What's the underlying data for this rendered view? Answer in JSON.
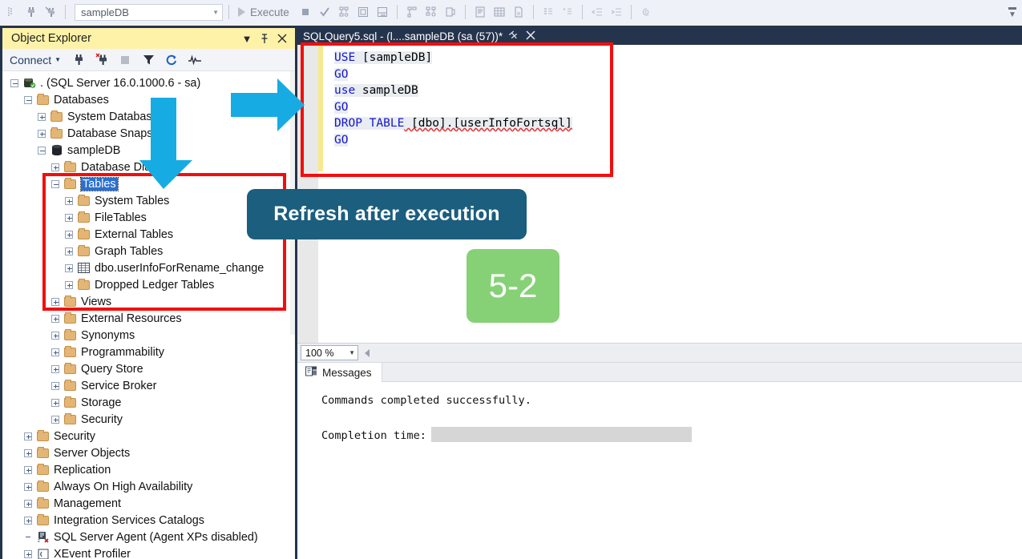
{
  "toolbar": {
    "database_value": "sampleDB",
    "execute_label": "Execute",
    "icons": [
      "connect-object-explorer-icon",
      "new-query-icon",
      "new-query-with-current-connection-icon",
      "stop-icon",
      "parse-icon",
      "display-estimated-execution-plan-icon",
      "query-options-icon",
      "intellisense-icon",
      "include-actual-execution-plan-icon",
      "include-live-query-statistics-icon",
      "include-client-statistics-icon",
      "results-to-text-icon",
      "results-to-grid-icon",
      "results-to-file-icon",
      "comment-icon",
      "uncomment-icon",
      "decrease-indent-icon",
      "increase-indent-icon",
      "specify-values-for-template-parameters-icon"
    ]
  },
  "object_explorer": {
    "title": "Object Explorer",
    "connect_label": "Connect",
    "toolbar_icons": [
      "connect-icon",
      "disconnect-icon",
      "stop-icon",
      "filter-icon",
      "refresh-icon",
      "activity-monitor-icon"
    ],
    "tree": [
      {
        "label": ". (SQL Server 16.0.1000.6 - sa)",
        "indent": 0,
        "expander": "minus",
        "icon": "server-icon"
      },
      {
        "label": "Databases",
        "indent": 1,
        "expander": "minus",
        "icon": "folder-icon"
      },
      {
        "label": "System Databases",
        "indent": 2,
        "expander": "plus",
        "icon": "folder-icon"
      },
      {
        "label": "Database Snapshots",
        "indent": 2,
        "expander": "plus",
        "icon": "folder-icon"
      },
      {
        "label": "sampleDB",
        "indent": 2,
        "expander": "minus",
        "icon": "database-icon"
      },
      {
        "label": "Database Diagrams",
        "indent": 3,
        "expander": "plus",
        "icon": "folder-icon"
      },
      {
        "label": "Tables",
        "indent": 3,
        "expander": "minus",
        "icon": "folder-icon",
        "selected": true
      },
      {
        "label": "System Tables",
        "indent": 4,
        "expander": "plus",
        "icon": "folder-icon"
      },
      {
        "label": "FileTables",
        "indent": 4,
        "expander": "plus",
        "icon": "folder-icon"
      },
      {
        "label": "External Tables",
        "indent": 4,
        "expander": "plus",
        "icon": "folder-icon"
      },
      {
        "label": "Graph Tables",
        "indent": 4,
        "expander": "plus",
        "icon": "folder-icon"
      },
      {
        "label": "dbo.userInfoForRename_change",
        "indent": 4,
        "expander": "plus",
        "icon": "table-icon"
      },
      {
        "label": "Dropped Ledger Tables",
        "indent": 4,
        "expander": "plus",
        "icon": "folder-icon"
      },
      {
        "label": "Views",
        "indent": 3,
        "expander": "plus",
        "icon": "folder-icon"
      },
      {
        "label": "External Resources",
        "indent": 3,
        "expander": "plus",
        "icon": "folder-icon"
      },
      {
        "label": "Synonyms",
        "indent": 3,
        "expander": "plus",
        "icon": "folder-icon"
      },
      {
        "label": "Programmability",
        "indent": 3,
        "expander": "plus",
        "icon": "folder-icon"
      },
      {
        "label": "Query Store",
        "indent": 3,
        "expander": "plus",
        "icon": "folder-icon"
      },
      {
        "label": "Service Broker",
        "indent": 3,
        "expander": "plus",
        "icon": "folder-icon"
      },
      {
        "label": "Storage",
        "indent": 3,
        "expander": "plus",
        "icon": "folder-icon"
      },
      {
        "label": "Security",
        "indent": 3,
        "expander": "plus",
        "icon": "folder-icon"
      },
      {
        "label": "Security",
        "indent": 1,
        "expander": "plus",
        "icon": "folder-icon"
      },
      {
        "label": "Server Objects",
        "indent": 1,
        "expander": "plus",
        "icon": "folder-icon"
      },
      {
        "label": "Replication",
        "indent": 1,
        "expander": "plus",
        "icon": "folder-icon"
      },
      {
        "label": "Always On High Availability",
        "indent": 1,
        "expander": "plus",
        "icon": "folder-icon"
      },
      {
        "label": "Management",
        "indent": 1,
        "expander": "plus",
        "icon": "folder-icon"
      },
      {
        "label": "Integration Services Catalogs",
        "indent": 1,
        "expander": "plus",
        "icon": "folder-icon"
      },
      {
        "label": "SQL Server Agent (Agent XPs disabled)",
        "indent": 1,
        "expander": "none",
        "icon": "agent-icon"
      },
      {
        "label": "XEvent Profiler",
        "indent": 1,
        "expander": "plus",
        "icon": "xevent-icon"
      }
    ]
  },
  "query_tab": {
    "title": "SQLQuery5.sql - (l....sampleDB (sa (57))*",
    "pin_icon": "pin-icon",
    "close_icon": "close-icon"
  },
  "editor": {
    "lines": [
      {
        "parts": [
          {
            "t": "USE",
            "c": "kw"
          },
          {
            "t": " [sampleDB]",
            "c": "pl"
          }
        ]
      },
      {
        "parts": [
          {
            "t": "GO",
            "c": "kw"
          }
        ]
      },
      {
        "parts": [
          {
            "t": "use",
            "c": "kw"
          },
          {
            "t": " sampleDB",
            "c": "pl"
          }
        ]
      },
      {
        "parts": [
          {
            "t": "GO",
            "c": "kw"
          }
        ]
      },
      {
        "parts": [
          {
            "t": "DROP TABLE",
            "c": "kw"
          },
          {
            "t": " [dbo].[userInfoFortsql]",
            "c": "pl squig"
          }
        ]
      },
      {
        "parts": [
          {
            "t": "GO",
            "c": "kw"
          }
        ]
      }
    ]
  },
  "zoom_bar": {
    "value": "100 %"
  },
  "results": {
    "tab_label": "Messages",
    "tab_icon": "messages-icon",
    "line1": "Commands completed successfully.",
    "line2_label": "Completion time:"
  },
  "annotations": {
    "callout_text": "Refresh after execution",
    "badge_text": "5-2",
    "colors": {
      "red_box": "#f40d0d",
      "arrow_blue": "#16ace3",
      "callout_teal": "#1b5e7e",
      "badge_green": "#86d176",
      "title_yellow": "#fdf2a8"
    }
  }
}
